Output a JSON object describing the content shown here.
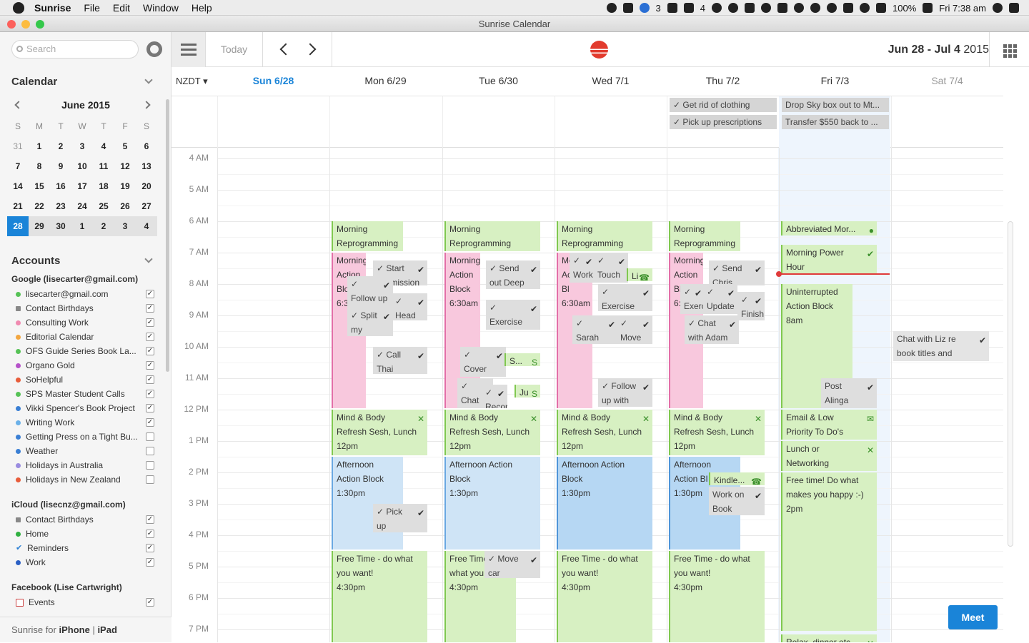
{
  "menubar": {
    "app": "Sunrise",
    "items": [
      "File",
      "Edit",
      "Window",
      "Help"
    ],
    "badge1": "3",
    "badge2": "4",
    "battery": "100%",
    "clock": "Fri 7:38 am"
  },
  "window": {
    "title": "Sunrise Calendar"
  },
  "sidebar": {
    "search_placeholder": "Search",
    "calendar_header": "Calendar",
    "mini": {
      "month": "June 2015",
      "dow": [
        "S",
        "M",
        "T",
        "W",
        "T",
        "F",
        "S"
      ],
      "weeks": [
        [
          "31",
          "1",
          "2",
          "3",
          "4",
          "5",
          "6"
        ],
        [
          "7",
          "8",
          "9",
          "10",
          "11",
          "12",
          "13"
        ],
        [
          "14",
          "15",
          "16",
          "17",
          "18",
          "19",
          "20"
        ],
        [
          "21",
          "22",
          "23",
          "24",
          "25",
          "26",
          "27"
        ],
        [
          "28",
          "29",
          "30",
          "1",
          "2",
          "3",
          "4"
        ]
      ],
      "today": "28"
    },
    "accounts_header": "Accounts",
    "google": {
      "name": "Google (lisecarter@gmail.com)",
      "items": [
        {
          "name": "lisecarter@gmail.com",
          "color": "#56c256",
          "checked": true
        },
        {
          "name": "Contact Birthdays",
          "color": "#888888",
          "checked": true,
          "icon": "grid"
        },
        {
          "name": "Consulting Work",
          "color": "#f08ab0",
          "checked": true
        },
        {
          "name": "Editorial Calendar",
          "color": "#f2a640",
          "checked": true
        },
        {
          "name": "OFS Guide Series Book La...",
          "color": "#56c256",
          "checked": true
        },
        {
          "name": "Organo Gold",
          "color": "#b552c9",
          "checked": true
        },
        {
          "name": "SoHelpful",
          "color": "#e85c3a",
          "checked": true
        },
        {
          "name": "SPS Master Student Calls",
          "color": "#56c256",
          "checked": true
        },
        {
          "name": "Vikki Spencer's Book Project",
          "color": "#3a7fd4",
          "checked": true
        },
        {
          "name": "Writing Work",
          "color": "#6ab0e8",
          "checked": true
        },
        {
          "name": "Getting Press on a Tight Bu...",
          "color": "#3a7fd4",
          "checked": false
        },
        {
          "name": "Weather",
          "color": "#3a7fd4",
          "checked": false
        },
        {
          "name": "Holidays in Australia",
          "color": "#9a8ce0",
          "checked": false
        },
        {
          "name": "Holidays in New Zealand",
          "color": "#e85c3a",
          "checked": false
        }
      ]
    },
    "icloud": {
      "name": "iCloud (lisecnz@gmail.com)",
      "items": [
        {
          "name": "Contact Birthdays",
          "color": "#888888",
          "checked": true,
          "icon": "grid"
        },
        {
          "name": "Home",
          "color": "#30b040",
          "checked": true
        },
        {
          "name": "Reminders",
          "color": "#2a7fd4",
          "checked": true,
          "icon": "check"
        },
        {
          "name": "Work",
          "color": "#2a5fc4",
          "checked": true
        }
      ]
    },
    "facebook": {
      "name": "Facebook (Lise Cartwright)",
      "items": [
        {
          "name": "Events",
          "color": "#cc4444",
          "checked": true,
          "icon": "cal"
        }
      ]
    },
    "footer": {
      "prefix": "Sunrise for ",
      "iphone": "iPhone",
      "sep": " | ",
      "ipad": "iPad"
    }
  },
  "toolbar": {
    "today": "Today",
    "range_dates": "Jun 28 - Jul 4",
    "range_year": "2015"
  },
  "week": {
    "timezone": "NZDT",
    "days": [
      {
        "label": "Sun 6/28",
        "color": "#1a84d8",
        "bold": true
      },
      {
        "label": "Mon 6/29"
      },
      {
        "label": "Tue 6/30"
      },
      {
        "label": "Wed 7/1"
      },
      {
        "label": "Thu 7/2"
      },
      {
        "label": "Fri 7/3"
      },
      {
        "label": "Sat 7/4",
        "color": "#999999"
      }
    ],
    "hours": [
      "4 AM",
      "5 AM",
      "6 AM",
      "7 AM",
      "8 AM",
      "9 AM",
      "10 AM",
      "11 AM",
      "12 PM",
      "1 PM",
      "2 PM",
      "3 PM",
      "4 PM",
      "5 PM",
      "6 PM",
      "7 PM"
    ],
    "allday": [
      {
        "day": 4,
        "row": 0,
        "text": "✓ Get rid of clothing"
      },
      {
        "day": 4,
        "row": 1,
        "text": "✓ Pick up prescriptions"
      },
      {
        "day": 5,
        "row": 0,
        "text": "Drop Sky box out to Mt..."
      },
      {
        "day": 5,
        "row": 1,
        "text": "Transfer $550 back to ..."
      }
    ],
    "events": [
      {
        "day": 1,
        "start": 6,
        "end": 7,
        "col": 0,
        "w": 100,
        "cls": "g",
        "lines": [
          "Morning",
          "Reprogramming"
        ]
      },
      {
        "day": 1,
        "start": 7,
        "end": 12,
        "col": 0,
        "w": 48,
        "cls": "p",
        "lines": [
          "Morning",
          "Action",
          "Block",
          "6:30am"
        ]
      },
      {
        "day": 1,
        "start": 7.25,
        "end": 8.1,
        "col": 58,
        "w": 76,
        "cls": "gr",
        "lines": [
          "✓ Start",
          "submission"
        ],
        "mark": "✔"
      },
      {
        "day": 1,
        "start": 7.75,
        "end": 9.25,
        "col": 22,
        "w": 64,
        "cls": "gr",
        "lines": [
          "✓",
          "Follow up"
        ],
        "mark": "✔"
      },
      {
        "day": 1,
        "start": 8.3,
        "end": 9.2,
        "col": 84,
        "w": 50,
        "cls": "gr",
        "lines": [
          "✓",
          "Head to"
        ],
        "mark": "✔"
      },
      {
        "day": 1,
        "start": 8.75,
        "end": 9.7,
        "col": 22,
        "w": 64,
        "cls": "gr",
        "lines": [
          "✓ Split",
          "my"
        ],
        "mark": "✔"
      },
      {
        "day": 1,
        "start": 10,
        "end": 10.9,
        "col": 58,
        "w": 76,
        "cls": "gr",
        "lines": [
          "✓ Call",
          "Thai"
        ],
        "mark": "✔"
      },
      {
        "day": 1,
        "start": 12,
        "end": 13.5,
        "col": 0,
        "w": 134,
        "cls": "g",
        "lines": [
          "Mind & Body",
          "Refresh Sesh, Lunch",
          "12pm"
        ],
        "mark": "✕",
        "mkgreen": true
      },
      {
        "day": 1,
        "start": 13.5,
        "end": 16.5,
        "col": 0,
        "w": 100,
        "cls": "b",
        "lines": [
          "Afternoon",
          "Action Block",
          "1:30pm"
        ]
      },
      {
        "day": 1,
        "start": 15,
        "end": 15.95,
        "col": 58,
        "w": 76,
        "cls": "gr",
        "lines": [
          "✓ Pick",
          "up"
        ],
        "mark": "✔"
      },
      {
        "day": 1,
        "start": 16.5,
        "end": 19.6,
        "col": 0,
        "w": 134,
        "cls": "g",
        "lines": [
          "Free Time - do what",
          "you want!",
          "4:30pm"
        ]
      },
      {
        "day": 2,
        "start": 6,
        "end": 7,
        "col": 0,
        "w": 134,
        "cls": "g",
        "lines": [
          "Morning",
          "Reprogramming"
        ]
      },
      {
        "day": 2,
        "start": 7,
        "end": 12,
        "col": 0,
        "w": 50,
        "cls": "p",
        "lines": [
          "Morning",
          "Action",
          "Block",
          "6:30am"
        ]
      },
      {
        "day": 2,
        "start": 7.25,
        "end": 8.2,
        "col": 58,
        "w": 76,
        "cls": "gr",
        "lines": [
          "✓ Send",
          "out Deep"
        ],
        "mark": "✔"
      },
      {
        "day": 2,
        "start": 8.5,
        "end": 9.5,
        "col": 58,
        "w": 76,
        "cls": "gr",
        "lines": [
          "✓",
          "Exercise"
        ],
        "mark": "✔"
      },
      {
        "day": 2,
        "start": 10,
        "end": 11,
        "col": 22,
        "w": 64,
        "cls": "gr",
        "lines": [
          "✓",
          "Cover and"
        ],
        "mark": "✔"
      },
      {
        "day": 2,
        "start": 10.2,
        "end": 10.6,
        "col": 84,
        "w": 50,
        "cls": "g",
        "lines": [
          "S..."
        ],
        "mark": "S",
        "mkgreen": true
      },
      {
        "day": 2,
        "start": 11,
        "end": 12,
        "col": 18,
        "w": 50,
        "cls": "gr",
        "lines": [
          "✓",
          "Chat"
        ],
        "mark": "✔"
      },
      {
        "day": 2,
        "start": 11.2,
        "end": 12,
        "col": 52,
        "w": 36,
        "cls": "gr",
        "lines": [
          "✓",
          "Record"
        ],
        "mark": "✔"
      },
      {
        "day": 2,
        "start": 11.2,
        "end": 11.6,
        "col": 98,
        "w": 36,
        "cls": "g",
        "lines": [
          "Ju"
        ],
        "mark": "S",
        "mkgreen": true
      },
      {
        "day": 2,
        "start": 12,
        "end": 13.5,
        "col": 0,
        "w": 134,
        "cls": "g",
        "lines": [
          "Mind & Body",
          "Refresh Sesh, Lunch",
          "12pm"
        ],
        "mark": "✕",
        "mkgreen": true
      },
      {
        "day": 2,
        "start": 13.5,
        "end": 16.5,
        "col": 0,
        "w": 134,
        "cls": "b",
        "lines": [
          "Afternoon Action",
          "Block",
          "1:30pm"
        ]
      },
      {
        "day": 2,
        "start": 16.5,
        "end": 19.6,
        "col": 0,
        "w": 100,
        "cls": "g",
        "lines": [
          "Free Time - do",
          "what you",
          "4:30pm"
        ]
      },
      {
        "day": 2,
        "start": 16.5,
        "end": 17.4,
        "col": 56,
        "w": 78,
        "cls": "gr",
        "lines": [
          "✓ Move",
          "car"
        ],
        "mark": "✔"
      },
      {
        "day": 3,
        "start": 6,
        "end": 7,
        "col": 0,
        "w": 134,
        "cls": "g",
        "lines": [
          "Morning",
          "Reprogramming"
        ]
      },
      {
        "day": 3,
        "start": 7,
        "end": 12,
        "col": 0,
        "w": 50,
        "cls": "p",
        "lines": [
          "Morning",
          "Ac",
          "Bl",
          "6:30am"
        ]
      },
      {
        "day": 3,
        "start": 7,
        "end": 8,
        "col": 18,
        "w": 36,
        "cls": "gr",
        "lines": [
          "✓",
          "Work"
        ],
        "mark": "✔"
      },
      {
        "day": 3,
        "start": 7,
        "end": 8,
        "col": 52,
        "w": 48,
        "cls": "gr",
        "lines": [
          "✓",
          "Touch"
        ],
        "mark": "✔"
      },
      {
        "day": 3,
        "start": 7.5,
        "end": 7.95,
        "col": 98,
        "w": 36,
        "cls": "g",
        "lines": [
          "Li"
        ],
        "mark": "☎",
        "mkgreen": true
      },
      {
        "day": 3,
        "start": 8,
        "end": 8.9,
        "col": 58,
        "w": 76,
        "cls": "gr",
        "lines": [
          "✓",
          "Exercise"
        ],
        "mark": "✔"
      },
      {
        "day": 3,
        "start": 9,
        "end": 9.95,
        "col": 22,
        "w": 64,
        "cls": "gr",
        "lines": [
          "✓",
          "Sarah"
        ],
        "mark": "✔"
      },
      {
        "day": 3,
        "start": 9,
        "end": 9.95,
        "col": 84,
        "w": 50,
        "cls": "gr",
        "lines": [
          "✓",
          "Move"
        ],
        "mark": "✔"
      },
      {
        "day": 3,
        "start": 11,
        "end": 11.95,
        "col": 58,
        "w": 76,
        "cls": "gr",
        "lines": [
          "✓ Follow",
          "up with"
        ],
        "mark": "✔"
      },
      {
        "day": 3,
        "start": 12,
        "end": 13.5,
        "col": 0,
        "w": 134,
        "cls": "g",
        "lines": [
          "Mind & Body",
          "Refresh Sesh, Lunch",
          "12pm"
        ],
        "mark": "✕",
        "mkgreen": true
      },
      {
        "day": 3,
        "start": 13.5,
        "end": 16.5,
        "col": 0,
        "w": 134,
        "cls": "b2",
        "lines": [
          "Afternoon Action",
          "Block",
          "1:30pm"
        ]
      },
      {
        "day": 3,
        "start": 16.5,
        "end": 19.6,
        "col": 0,
        "w": 134,
        "cls": "g",
        "lines": [
          "Free Time - do what",
          "you want!",
          "4:30pm"
        ]
      },
      {
        "day": 4,
        "start": 6,
        "end": 7,
        "col": 0,
        "w": 100,
        "cls": "g",
        "lines": [
          "Morning",
          "Reprogramming"
        ]
      },
      {
        "day": 4,
        "start": 7,
        "end": 12,
        "col": 0,
        "w": 48,
        "cls": "p",
        "lines": [
          "Morning",
          "Action",
          "Block",
          "6:"
        ]
      },
      {
        "day": 4,
        "start": 7.25,
        "end": 8.1,
        "col": 56,
        "w": 78,
        "cls": "gr",
        "lines": [
          "✓ Send",
          "Chris"
        ],
        "mark": "✔"
      },
      {
        "day": 4,
        "start": 8,
        "end": 9,
        "col": 16,
        "w": 34,
        "cls": "gr",
        "lines": [
          "✓",
          "Exerc"
        ],
        "mark": "✔"
      },
      {
        "day": 4,
        "start": 8,
        "end": 9,
        "col": 48,
        "w": 48,
        "cls": "gr",
        "lines": [
          "✓",
          "Update"
        ],
        "mark": "✔"
      },
      {
        "day": 4,
        "start": 8.25,
        "end": 9.2,
        "col": 96,
        "w": 38,
        "cls": "gr",
        "lines": [
          "✓",
          "Finish"
        ],
        "mark": "✔"
      },
      {
        "day": 4,
        "start": 9,
        "end": 9.95,
        "col": 22,
        "w": 76,
        "cls": "gr",
        "lines": [
          "✓ Chat",
          "with Adam"
        ],
        "mark": "✔"
      },
      {
        "day": 4,
        "start": 12,
        "end": 13.5,
        "col": 0,
        "w": 134,
        "cls": "g",
        "lines": [
          "Mind & Body",
          "Refresh Sesh, Lunch",
          "12pm"
        ],
        "mark": "✕",
        "mkgreen": true
      },
      {
        "day": 4,
        "start": 13.5,
        "end": 16.5,
        "col": 0,
        "w": 100,
        "cls": "b2",
        "lines": [
          "Afternoon",
          "Action Bl",
          "1:30pm"
        ]
      },
      {
        "day": 4,
        "start": 14,
        "end": 14.45,
        "col": 56,
        "w": 78,
        "cls": "g",
        "lines": [
          "Kindle..."
        ],
        "mark": "☎",
        "mkgreen": true
      },
      {
        "day": 4,
        "start": 14.45,
        "end": 15.4,
        "col": 56,
        "w": 78,
        "cls": "gr",
        "lines": [
          "Work on",
          "Book"
        ],
        "mark": "✔"
      },
      {
        "day": 4,
        "start": 16.5,
        "end": 19.6,
        "col": 0,
        "w": 134,
        "cls": "g",
        "lines": [
          "Free Time - do what",
          "you want!",
          "4:30pm"
        ]
      },
      {
        "day": 5,
        "start": 6,
        "end": 6.5,
        "col": 0,
        "w": 134,
        "cls": "g",
        "lines": [
          "Abbreviated Mor..."
        ],
        "mark": "●",
        "mkgreen": true
      },
      {
        "day": 5,
        "start": 6.75,
        "end": 7.75,
        "col": 0,
        "w": 134,
        "cls": "g",
        "lines": [
          "Morning Power",
          "Hour"
        ],
        "mark": "✔",
        "mkgreen": true
      },
      {
        "day": 5,
        "start": 8,
        "end": 12,
        "col": 0,
        "w": 100,
        "cls": "g",
        "lines": [
          "Uninterrupted",
          "Action Block",
          "8am"
        ]
      },
      {
        "day": 5,
        "start": 11,
        "end": 12,
        "col": 56,
        "w": 78,
        "cls": "gr",
        "lines": [
          "Post",
          "Alinga"
        ],
        "mark": "✔"
      },
      {
        "day": 5,
        "start": 12,
        "end": 13,
        "col": 0,
        "w": 134,
        "cls": "g",
        "lines": [
          "Email & Low",
          "Priority To Do's"
        ],
        "mark": "✉",
        "mkgreen": true
      },
      {
        "day": 5,
        "start": 13,
        "end": 14,
        "col": 0,
        "w": 134,
        "cls": "g",
        "lines": [
          "Lunch or",
          "Networking"
        ],
        "mark": "✕",
        "mkgreen": true
      },
      {
        "day": 5,
        "start": 14,
        "end": 19.1,
        "col": 0,
        "w": 134,
        "cls": "g",
        "lines": [
          "Free time! Do what",
          "makes you happy :-)",
          "2pm"
        ]
      },
      {
        "day": 5,
        "start": 19.15,
        "end": 19.6,
        "col": 0,
        "w": 134,
        "cls": "g",
        "lines": [
          "Relax, dinner etc"
        ],
        "mark": "✕",
        "mkgreen": true
      },
      {
        "day": 6,
        "start": 9.5,
        "end": 10.5,
        "col": 0,
        "w": 134,
        "cls": "gry",
        "lines": [
          "Chat with Liz re",
          "book titles and"
        ],
        "mark": "✔"
      }
    ],
    "meet": "Meet"
  }
}
